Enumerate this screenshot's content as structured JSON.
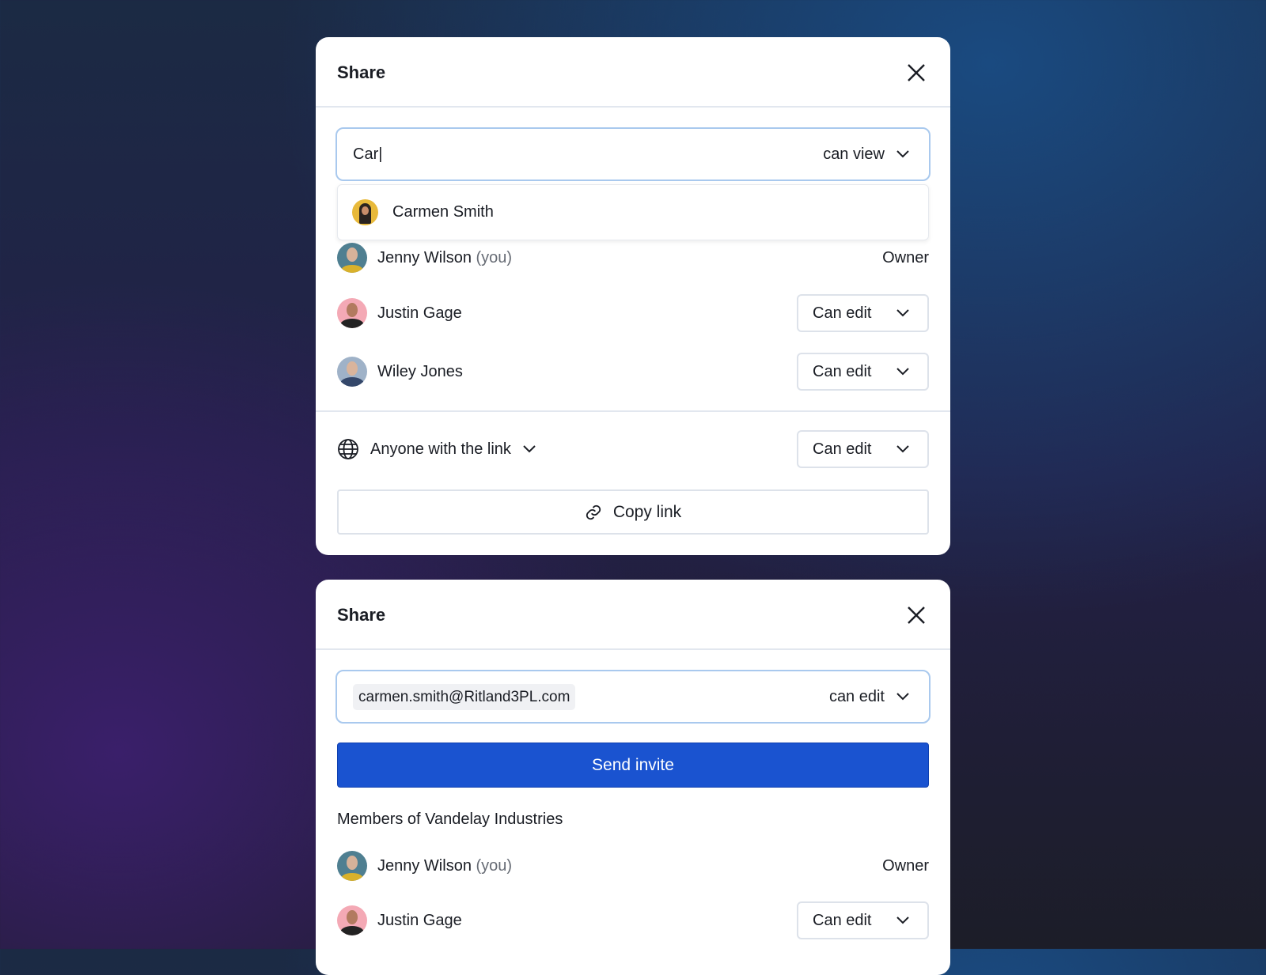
{
  "colors": {
    "accent": "#1a53d0",
    "focus_border": "#a9c9ee"
  },
  "panel1": {
    "title": "Share",
    "search_value": "Car|",
    "search_permission": "can view",
    "suggestion": {
      "name": "Carmen Smith"
    },
    "members": [
      {
        "name": "Jenny Wilson",
        "suffix": "(you)",
        "role": "Owner"
      },
      {
        "name": "Justin Gage",
        "role": "Can edit"
      },
      {
        "name": "Wiley Jones",
        "role": "Can edit"
      }
    ],
    "link_access": "Anyone with the link",
    "link_permission": "Can edit",
    "copy_link": "Copy link"
  },
  "panel2": {
    "title": "Share",
    "email_chip": "carmen.smith@Ritland3PL.com",
    "permission": "can edit",
    "send_invite": "Send invite",
    "members_label": "Members of Vandelay Industries",
    "members": [
      {
        "name": "Jenny Wilson",
        "suffix": "(you)",
        "role": "Owner"
      },
      {
        "name": "Justin Gage",
        "role": "Can edit"
      }
    ]
  }
}
